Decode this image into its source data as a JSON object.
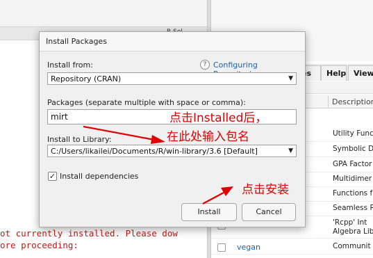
{
  "background": {
    "left_toolbar_fragment": "R Sol",
    "console_lines": [
      "ot currently installed. Please dow",
      "ore proceeding:"
    ],
    "tabs": {
      "packages_fragment": "es",
      "help": "Help",
      "viewer_fragment": "View"
    },
    "table_header_description": "Description",
    "packages": [
      {
        "name": "",
        "description": "Utility Func"
      },
      {
        "name": "",
        "description": "Symbolic D"
      },
      {
        "name": "",
        "description": "GPA Factor"
      },
      {
        "name": "",
        "description": "Multidimer"
      },
      {
        "name": "",
        "description": "Functions f"
      },
      {
        "name": "",
        "description": "Seamless R"
      },
      {
        "name": "",
        "description": "'Rcpp' Int\nAlgebra Lib"
      },
      {
        "name": "vegan",
        "description": "Communit"
      }
    ]
  },
  "dialog": {
    "title": "Install Packages",
    "install_from_label": "Install from:",
    "configuring_link": "Configuring Repositories",
    "install_from_value": "Repository (CRAN)",
    "packages_label": "Packages (separate multiple with space or comma):",
    "packages_value": "mirt",
    "library_label": "Install to Library:",
    "library_value": "C:/Users/likailei/Documents/R/win-library/3.6 [Default]",
    "install_dependencies_label": "Install dependencies",
    "install_dependencies_checked": true,
    "install_button": "Install",
    "cancel_button": "Cancel"
  },
  "annotations": {
    "click_installed": "点击Installed后，",
    "enter_package": "在此处输入包名",
    "click_install": "点击安装",
    "color": "#e00000"
  }
}
